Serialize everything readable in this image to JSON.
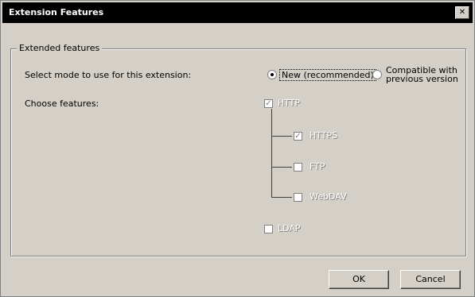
{
  "window": {
    "title": "Extension Features",
    "close_icon": "close-icon"
  },
  "group": {
    "legend": "Extended features"
  },
  "row1": {
    "label": "Select mode to use for this extension:",
    "radio_a": {
      "label": "New (recommended)",
      "selected": true
    },
    "radio_b": {
      "label": "Compatible with previous version",
      "selected": false
    }
  },
  "row2": {
    "label": "Choose features:"
  },
  "features": {
    "root": {
      "label": "HTTP",
      "checked": true
    },
    "children": [
      {
        "label": "HTTPS",
        "checked": true
      },
      {
        "label": "FTP",
        "checked": false
      },
      {
        "label": "WebDAV",
        "checked": false
      }
    ],
    "other": {
      "label": "LDAP",
      "checked": false
    }
  },
  "buttons": {
    "ok": "OK",
    "cancel": "Cancel"
  }
}
